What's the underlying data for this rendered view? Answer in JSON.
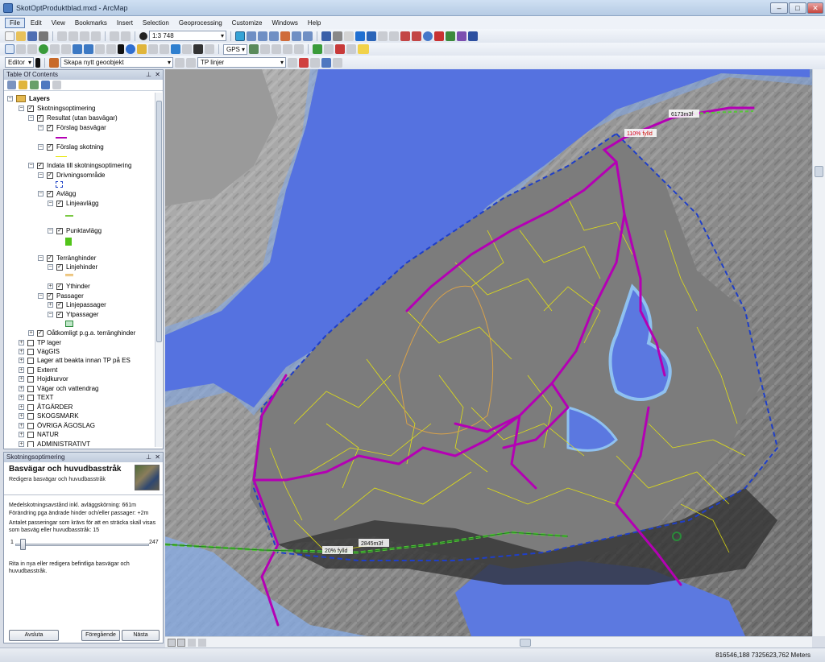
{
  "window": {
    "title": "SkotOptProduktblad.mxd - ArcMap"
  },
  "menu": [
    "File",
    "Edit",
    "View",
    "Bookmarks",
    "Insert",
    "Selection",
    "Geoprocessing",
    "Customize",
    "Windows",
    "Help"
  ],
  "toolbar": {
    "scale": "1:3 748",
    "gps_label": "GPS"
  },
  "editor": {
    "editor_label": "Editor",
    "create_feature": "Skapa nytt geoobjekt",
    "layer_select": "TP linjer"
  },
  "toc": {
    "title": "Table Of Contents",
    "layers_root": "Layers",
    "rows": [
      {
        "label": "Skotningsoptimering",
        "checked": true
      },
      {
        "label": "Resultat (utan basvägar)",
        "checked": true
      },
      {
        "label": "Förslag basvägar",
        "checked": true
      },
      {
        "label": "Förslag skotning",
        "checked": true
      },
      {
        "label": "Indata till skotningsoptimering",
        "checked": true
      },
      {
        "label": "Drivningsområde",
        "checked": true
      },
      {
        "label": "Avlägg",
        "checked": true
      },
      {
        "label": "Linjeavlägg",
        "checked": true
      },
      {
        "label": "Punktavlägg",
        "checked": true
      },
      {
        "label": "Terränghinder",
        "checked": true
      },
      {
        "label": "Linjehinder",
        "checked": true
      },
      {
        "label": "Ythinder",
        "checked": true
      },
      {
        "label": "Passager",
        "checked": true
      },
      {
        "label": "Linjepassager",
        "checked": true
      },
      {
        "label": "Ytpassager",
        "checked": true
      },
      {
        "label": "Oåtkomligt p.g.a. terränghinder",
        "checked": true
      },
      {
        "label": "TP lager",
        "checked": false
      },
      {
        "label": "VägGIS",
        "checked": false
      },
      {
        "label": "Lager att beakta innan TP på ES",
        "checked": false
      },
      {
        "label": "Externt",
        "checked": false
      },
      {
        "label": "Hojdkurvor",
        "checked": false
      },
      {
        "label": "Vägar och vattendrag",
        "checked": false
      },
      {
        "label": "TEXT",
        "checked": false
      },
      {
        "label": "ÅTGÄRDER",
        "checked": false
      },
      {
        "label": "SKOGSMARK",
        "checked": false
      },
      {
        "label": "ÖVRIGA ÄGOSLAG",
        "checked": false
      },
      {
        "label": "NATUR",
        "checked": false
      },
      {
        "label": "ADMINISTRATIVT",
        "checked": false
      }
    ]
  },
  "optimizer": {
    "panel_title": "Skotningsoptimering",
    "step_title": "Basvägar och huvudbasstråk",
    "step_sub": "Redigera basvägar och huvudbasstråk",
    "line1": "Medelskotningsavstånd inkl. avläggskörning: 661m",
    "line2": "Förändring pga ändrade hinder och/eller passager: +2m",
    "line3": "Antalet passeringar som krävs för att en sträcka skall visas som basväg eller huvudbasstråk: 15",
    "slider_min": "1",
    "slider_max": "247",
    "slider_value": 15,
    "line4": "Rita in nya eller redigera befintliga basvägar och huvudbasstråk.",
    "btn_finish": "Avsluta",
    "btn_prev": "Föregående",
    "btn_next": "Nästa"
  },
  "map_labels": {
    "volume_top": "6173m3f",
    "fill_top": "110% fylld",
    "volume_bottom": "2845m3f",
    "fill_bottom": "20% fylld"
  },
  "status": {
    "coords": "816546,188  7325623,762 Meters"
  }
}
